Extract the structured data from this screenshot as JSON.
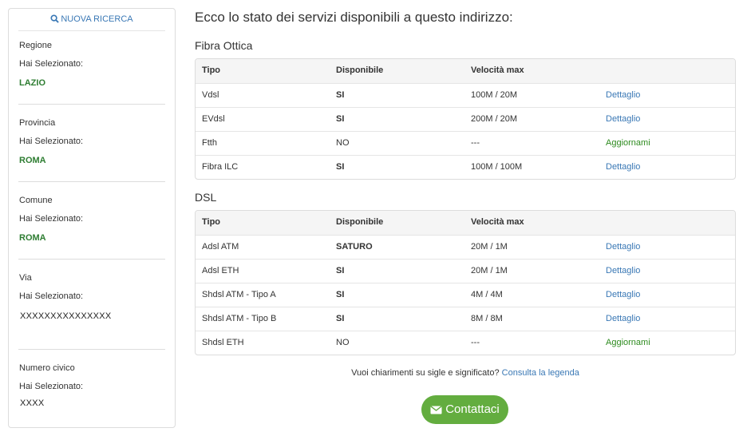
{
  "sidebar": {
    "new_search_label": "NUOVA RICERCA",
    "sections": [
      {
        "label": "Regione",
        "selected_label": "Hai Selezionato:",
        "value": "LAZIO"
      },
      {
        "label": "Provincia",
        "selected_label": "Hai Selezionato:",
        "value": "ROMA"
      },
      {
        "label": "Comune",
        "selected_label": "Hai Selezionato:",
        "value": "ROMA"
      },
      {
        "label": "Via",
        "selected_label": "Hai Selezionato:",
        "value": "XXXXXXXXXXXXXXX"
      },
      {
        "label": "Numero civico",
        "selected_label": "Hai Selezionato:",
        "value": "XXXX"
      }
    ]
  },
  "main": {
    "heading": "Ecco lo stato dei servizi disponibili a questo indirizzo:",
    "columns": {
      "tipo": "Tipo",
      "disponibile": "Disponibile",
      "velocita": "Velocità max"
    },
    "fibra": {
      "title": "Fibra Ottica",
      "rows": [
        {
          "tipo": "Vdsl",
          "disponibile": "SI",
          "velocita": "100M / 20M",
          "action": "Dettaglio"
        },
        {
          "tipo": "EVdsl",
          "disponibile": "SI",
          "velocita": "200M / 20M",
          "action": "Dettaglio"
        },
        {
          "tipo": "Ftth",
          "disponibile": "NO",
          "velocita": "---",
          "action": "Aggiornami"
        },
        {
          "tipo": "Fibra ILC",
          "disponibile": "SI",
          "velocita": "100M / 100M",
          "action": "Dettaglio"
        }
      ]
    },
    "dsl": {
      "title": "DSL",
      "rows": [
        {
          "tipo": "Adsl ATM",
          "disponibile": "SATURO",
          "velocita": "20M / 1M",
          "action": "Dettaglio"
        },
        {
          "tipo": "Adsl ETH",
          "disponibile": "SI",
          "velocita": "20M / 1M",
          "action": "Dettaglio"
        },
        {
          "tipo": "Shdsl ATM - Tipo A",
          "disponibile": "SI",
          "velocita": "4M / 4M",
          "action": "Dettaglio"
        },
        {
          "tipo": "Shdsl ATM - Tipo B",
          "disponibile": "SI",
          "velocita": "8M / 8M",
          "action": "Dettaglio"
        },
        {
          "tipo": "Shdsl ETH",
          "disponibile": "NO",
          "velocita": "---",
          "action": "Aggiornami"
        }
      ]
    },
    "help_text": "Vuoi chiarimenti su sigle e significato?",
    "help_link": "Consulta la legenda",
    "contact_label": "Contattaci"
  },
  "colors": {
    "link": "#3a78b5",
    "green_value": "#2e7d32",
    "button": "#63ad3f"
  }
}
